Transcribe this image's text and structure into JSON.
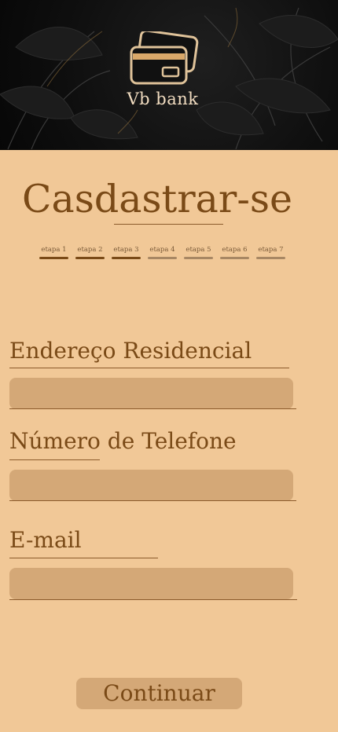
{
  "header": {
    "brand_name": "Vb bank",
    "logo_icon": "credit-card-icon",
    "background": "dark-leaves"
  },
  "page": {
    "title": "Casdastrar-se"
  },
  "steps": [
    {
      "label": "etapa 1",
      "completed": true
    },
    {
      "label": "etapa 2",
      "completed": true
    },
    {
      "label": "etapa 3",
      "completed": true
    },
    {
      "label": "etapa 4",
      "completed": false
    },
    {
      "label": "etapa 5",
      "completed": false
    },
    {
      "label": "etapa 6",
      "completed": false
    },
    {
      "label": "etapa 7",
      "completed": false
    }
  ],
  "form": {
    "address": {
      "label": "Endereço Residencial",
      "value": "",
      "placeholder": ""
    },
    "phone": {
      "label": "Número de Telefone",
      "value": "",
      "placeholder": ""
    },
    "email": {
      "label": "E-mail",
      "value": "",
      "placeholder": ""
    }
  },
  "actions": {
    "continue_label": "Continuar"
  },
  "colors": {
    "background": "#f1c897",
    "accent": "#7a4a17",
    "input_fill": "#d4a877",
    "header_bg": "#0f0f0f",
    "gold": "#d9a86a"
  }
}
